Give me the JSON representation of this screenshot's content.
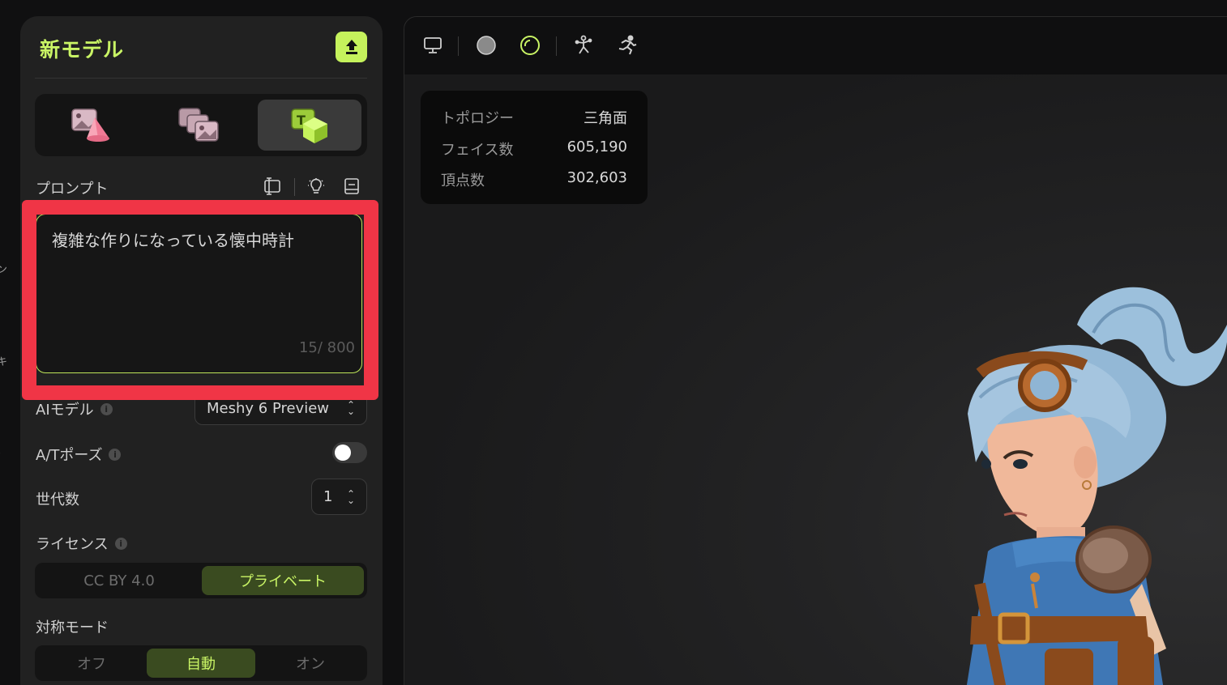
{
  "panel": {
    "title": "新モデル",
    "upload_icon": "upload-icon",
    "modes": [
      "image-to-3d-icon",
      "multi-image-to-3d-icon",
      "text-to-3d-icon"
    ],
    "active_mode": 2
  },
  "prompt": {
    "label": "プロンプト",
    "tools": [
      "text-cursor-icon",
      "lightbulb-icon",
      "book-icon"
    ],
    "value": "複雑な作りになっている懐中時計",
    "char_count": "15/ 800"
  },
  "settings": {
    "ai_model_label": "AIモデル",
    "ai_model_value": "Meshy 6 Preview",
    "at_pose_label": "A/Tポーズ",
    "at_pose_on": false,
    "generations_label": "世代数",
    "generations_value": "1",
    "license_label": "ライセンス",
    "license_options": [
      "CC BY 4.0",
      "プライベート"
    ],
    "license_selected": 1,
    "symmetry_label": "対称モード",
    "symmetry_options": [
      "オフ",
      "自動",
      "オン"
    ],
    "symmetry_selected": 1
  },
  "viewport": {
    "toolbar_icons": [
      "monitor-icon",
      "solid-sphere-icon",
      "wireframe-sphere-icon",
      "rig-icon",
      "running-icon"
    ],
    "stats": [
      {
        "label": "トポロジー",
        "value": "三角面"
      },
      {
        "label": "フェイス数",
        "value": "605,190"
      },
      {
        "label": "頂点数",
        "value": "302,603"
      }
    ]
  },
  "colors": {
    "accent": "#c9f465",
    "highlight": "#f03546"
  }
}
